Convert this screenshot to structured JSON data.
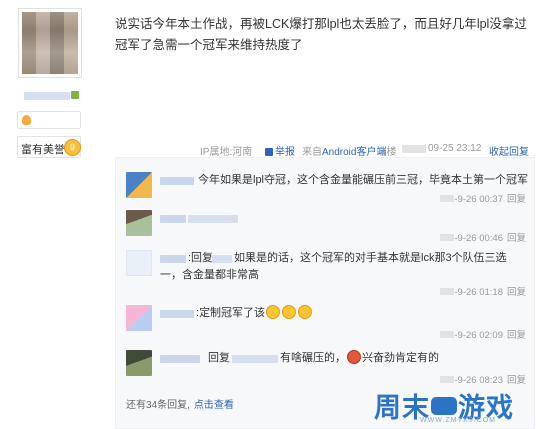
{
  "author": {
    "fan_badge": "",
    "rich_badge_label": "富有美誉",
    "rich_badge_level": "9"
  },
  "post": {
    "text": "说实话今年本土作战，再被LCK爆打那lpl也太丢脸了，而且好几年lpl没拿过冠军了急需一个冠军来维持热度了",
    "meta": {
      "ip_location": "IP属地:河南",
      "report": "举报",
      "source": "来自Android客户端",
      "floor": "4楼",
      "time": "09-25 23:12",
      "collapse_reply": "收起回复"
    }
  },
  "replies": [
    {
      "text": "今年如果是lpl夺冠，这个含金量能碾压前三冠，毕竟本土第一个冠军",
      "time": "-9-26 00:37",
      "reply_label": "回复"
    },
    {
      "text": "",
      "time": "-9-26 00:46",
      "reply_label": "回复"
    },
    {
      "prefix": ":回复",
      "text_line1": "如果是的话，这个冠军的对手基本就是lck那3个队伍三选",
      "text_line2": "一，含金量都非常高",
      "time": "-9-26 01:18",
      "reply_label": "回复"
    },
    {
      "text": "定制冠军了该",
      "time": "-9-26 02:09",
      "reply_label": "回复"
    },
    {
      "prefix": "回复",
      "text_a": "有啥碾压的，",
      "text_b": "兴奋劲肯定有的",
      "time": "-9-26 08:23",
      "reply_label": "回复"
    }
  ],
  "more_replies": {
    "count_text": "还有34条回复,",
    "link": "点击查看"
  },
  "watermark": {
    "brand_a": "周末",
    "brand_b": "游戏",
    "url": "WWW.ZMYX9.COM"
  },
  "colors": {
    "link": "#2d64b3",
    "watermark": "#2b74c5",
    "reply_bg": "#f7f8fa"
  }
}
